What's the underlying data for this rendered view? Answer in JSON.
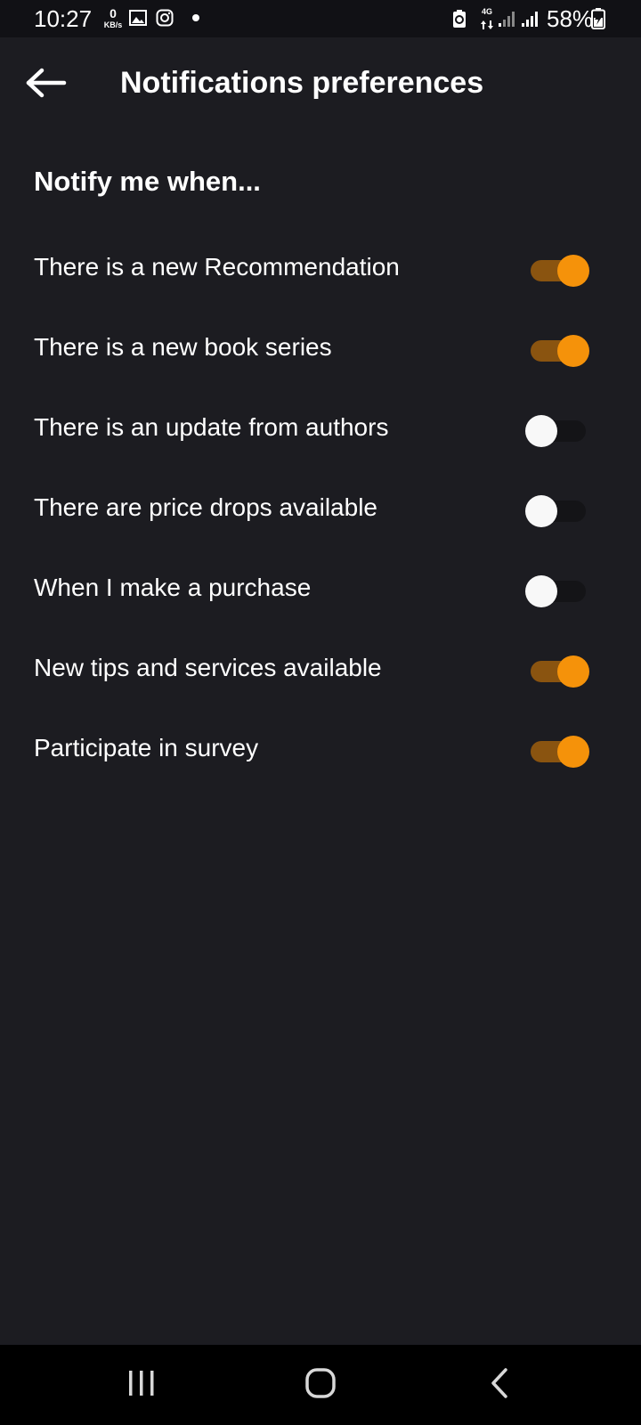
{
  "status_bar": {
    "time": "10:27",
    "speed_value": "0",
    "speed_unit": "KB/s",
    "network_type": "4G",
    "battery": "58%",
    "icons": [
      "gallery-icon",
      "instagram-icon",
      "notification-dot",
      "battery-saver-icon",
      "signal-icon",
      "signal-icon",
      "battery-charging-icon"
    ]
  },
  "app_bar": {
    "back_icon": "arrow-left-icon",
    "title": "Notifications preferences"
  },
  "section": {
    "heading": "Notify me when..."
  },
  "preferences": [
    {
      "label": "There is a new Recommendation",
      "enabled": true
    },
    {
      "label": "There is a new book series",
      "enabled": true
    },
    {
      "label": "There is an update from authors",
      "enabled": false
    },
    {
      "label": "There are price drops available",
      "enabled": false
    },
    {
      "label": "When I make a purchase",
      "enabled": false
    },
    {
      "label": "New tips and services available",
      "enabled": true
    },
    {
      "label": "Participate in survey",
      "enabled": true
    }
  ],
  "colors": {
    "background": "#1c1c21",
    "accent": "#f5920a",
    "accent_track": "#8a5410",
    "off_thumb": "#f8f8f8"
  },
  "nav_bar": {
    "icons": [
      "recent-apps-icon",
      "home-icon",
      "back-nav-icon"
    ]
  }
}
